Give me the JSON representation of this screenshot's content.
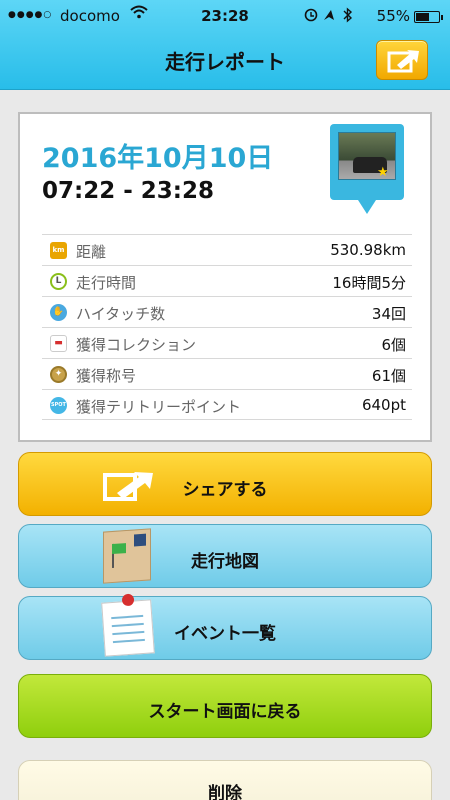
{
  "status_bar": {
    "signal": "●●●●○",
    "carrier": "docomo",
    "time": "23:28",
    "battery": "55%"
  },
  "header": {
    "title": "走行レポート"
  },
  "report": {
    "date": "2016年10月10日",
    "time_range": "07:22 - 23:28",
    "stats": [
      {
        "icon": "km-icon",
        "label": "距離",
        "value": "530.98km"
      },
      {
        "icon": "clock-icon",
        "label": "走行時間",
        "value": "16時間5分"
      },
      {
        "icon": "hand-icon",
        "label": "ハイタッチ数",
        "value": "34回"
      },
      {
        "icon": "car-icon",
        "label": "獲得コレクション",
        "value": "6個"
      },
      {
        "icon": "medal-icon",
        "label": "獲得称号",
        "value": "61個"
      },
      {
        "icon": "spot-icon",
        "label": "獲得テリトリーポイント",
        "value": "640pt"
      }
    ]
  },
  "buttons": {
    "share": "シェアする",
    "map": "走行地図",
    "events": "イベント一覧",
    "back_to_start": "スタート画面に戻る",
    "delete": "削除"
  },
  "colors": {
    "header_bg": "#28bde9",
    "date_text": "#2aa7d3",
    "share_button": "#f3b100",
    "map_button": "#6fcbe8",
    "start_button": "#8fcf0d"
  }
}
